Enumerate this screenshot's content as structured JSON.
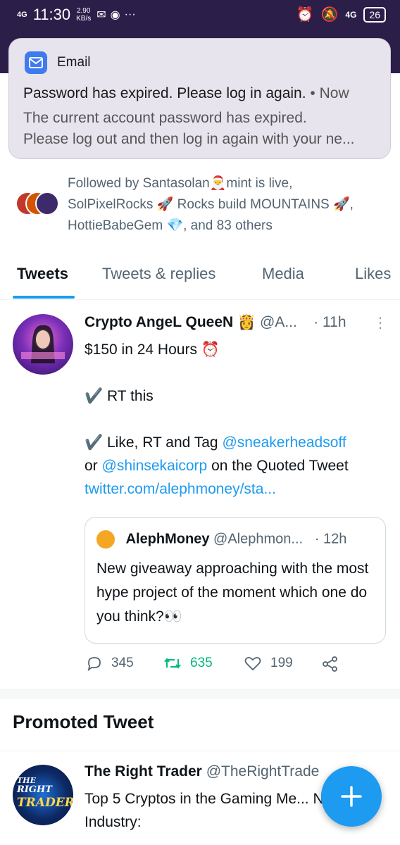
{
  "status_bar": {
    "network": "4G",
    "time": "11:30",
    "speed_value": "2.90",
    "speed_unit": "KB/s",
    "more": "···",
    "signal_4g": "4G",
    "battery": "26"
  },
  "notification": {
    "app_name": "Email",
    "title": "Password has expired. Please log in again.",
    "time": "Now",
    "body_line1": "The current account password has expired.",
    "body_line2": "Please log out and then log in again with your ne..."
  },
  "followed_by": {
    "line1": "Followed by Santasolan🎅mint is live,",
    "line2": "SolPixelRocks 🚀 Rocks build MOUNTAINS 🚀,",
    "line3": "HottieBabeGem  💎, and 83 others"
  },
  "tabs": {
    "tweets": "Tweets",
    "tweets_replies": "Tweets & replies",
    "media": "Media",
    "likes": "Likes"
  },
  "tweet": {
    "name": "Crypto AngeL QueeN 👸",
    "handle": "@A...",
    "separator": "·",
    "time": "11h",
    "line1": "$150 in 24 Hours ⏰",
    "line2_check": "✔️",
    "line2": "RT this",
    "line3_check": "✔️",
    "line3_prefix": "Like, RT and Tag ",
    "line3_mention": "@sneakerheadsoff",
    "line4_prefix": "or ",
    "line4_mention": "@shinsekaicorp",
    "line4_suffix": " on the Quoted Tweet",
    "link": "twitter.com/alephmoney/sta...",
    "quote": {
      "name": "AlephMoney",
      "handle": "@Alephmon...",
      "separator": "·",
      "time": "12h",
      "text": "New giveaway approaching with the most hype project of the moment which one do you think?👀"
    },
    "actions": {
      "replies": "345",
      "retweets": "635",
      "likes": "199"
    }
  },
  "promoted": {
    "section_title": "Promoted Tweet",
    "name": "The Right Trader",
    "handle": "@TheRightTrade",
    "text": "Top 5 Cryptos in the Gaming Me... NFT Industry:",
    "avatar_text_1": "THE",
    "avatar_text_2": "RIGHT",
    "avatar_text_3": "TRADER"
  },
  "colors": {
    "accent": "#1d9bf0",
    "retweet_green": "#00ba7c",
    "header_purple": "#2b1f4a"
  }
}
